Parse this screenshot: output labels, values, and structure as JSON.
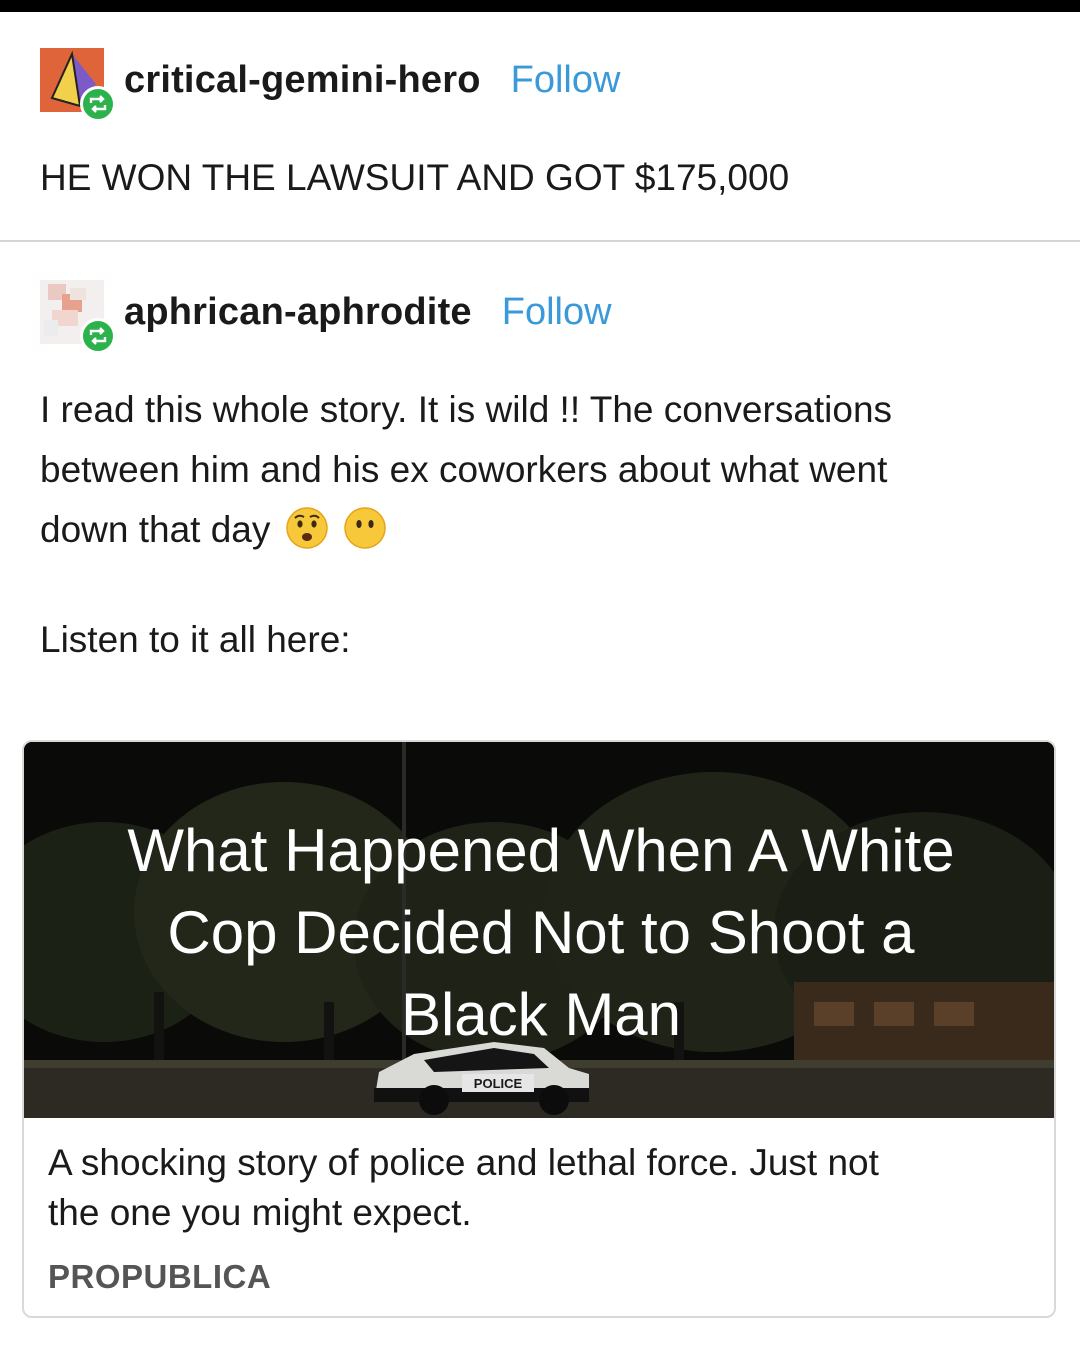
{
  "posts": [
    {
      "username": "critical-gemini-hero",
      "follow_label": "Follow",
      "text": "HE WON THE LAWSUIT AND GOT $175,000"
    },
    {
      "username": "aphrican-aphrodite",
      "follow_label": "Follow",
      "text_lines": [
        "I read this whole story. It is wild !! The conversations",
        "between him and his ex coworkers about what went",
        "down that day"
      ],
      "emojis": [
        "anguished-face-emoji",
        "face-without-mouth-emoji"
      ],
      "text2": "Listen to it all here:"
    }
  ],
  "link_card": {
    "image_title_lines": [
      "What Happened When A White",
      "Cop Decided Not to Shoot a",
      "Black Man"
    ],
    "image_sign_text": "POLICE",
    "description_lines": [
      "A shocking story of police and lethal force. Just not",
      "the one you might expect."
    ],
    "source": "PROPUBLICA"
  },
  "colors": {
    "follow": "#3a9ad9",
    "reblog_badge": "#2bb24c",
    "divider": "#d6d6d6"
  }
}
